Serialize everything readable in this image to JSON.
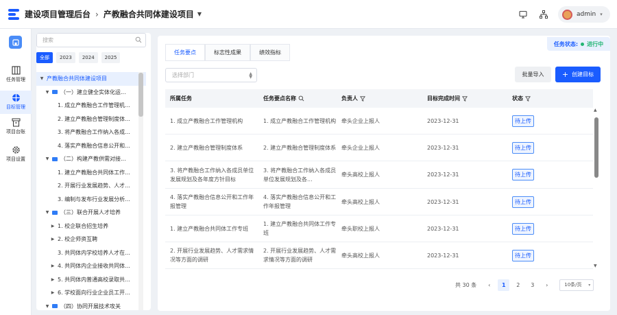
{
  "header": {
    "app_title": "建设项目管理后台",
    "project_title": "产教融合共同体建设项目",
    "user_name": "admin"
  },
  "leftnav": {
    "items": [
      {
        "label": "任务管理",
        "icon": "columns-icon"
      },
      {
        "label": "目标管理",
        "icon": "target-icon"
      },
      {
        "label": "项目台账",
        "icon": "ledger-icon"
      },
      {
        "label": "项目设置",
        "icon": "gear-icon"
      }
    ],
    "active_index": 1
  },
  "tree_panel": {
    "search_placeholder": "搜索",
    "years": [
      "全部",
      "2023",
      "2024",
      "2025"
    ],
    "active_year": "全部",
    "nodes": [
      {
        "label": "产教融合共同体建设项目",
        "level": 0,
        "arrow": "down",
        "selected": true,
        "folder": false
      },
      {
        "label": "（一）建立健全实体化运...",
        "level": 1,
        "arrow": "down",
        "folder": true
      },
      {
        "label": "1. 成立产教融合工作管理机...",
        "level": 2,
        "arrow": "",
        "folder": false
      },
      {
        "label": "2. 建立产教融合管理制度体...",
        "level": 2,
        "arrow": "",
        "folder": false
      },
      {
        "label": "3. 将产教融合工作纳入各成...",
        "level": 2,
        "arrow": "",
        "folder": false
      },
      {
        "label": "4. 落实产教融合信息公开和...",
        "level": 2,
        "arrow": "",
        "folder": false
      },
      {
        "label": "（二）构建产教供需对接...",
        "level": 1,
        "arrow": "down",
        "folder": true
      },
      {
        "label": "1. 建立产教融合共同体工作...",
        "level": 2,
        "arrow": "",
        "folder": false
      },
      {
        "label": "2. 开展行业发展趋势、人才...",
        "level": 2,
        "arrow": "",
        "folder": false
      },
      {
        "label": "3. 编制与发布行业发展分析...",
        "level": 2,
        "arrow": "",
        "folder": false
      },
      {
        "label": "（三）联合开展人才培养",
        "level": 1,
        "arrow": "down",
        "folder": true
      },
      {
        "label": "1. 校企联合招生培养",
        "level": 2,
        "arrow": "right",
        "folder": false
      },
      {
        "label": "2. 校企师资互聘",
        "level": 2,
        "arrow": "right",
        "folder": false
      },
      {
        "label": "3. 共同体内学校培养人才在...",
        "level": 2,
        "arrow": "",
        "folder": false
      },
      {
        "label": "4. 共同体内企业接收共同体...",
        "level": 2,
        "arrow": "right",
        "folder": false
      },
      {
        "label": "5. 共同体内普通高校录取共...",
        "level": 2,
        "arrow": "right",
        "folder": false
      },
      {
        "label": "6. 学校面向行业企业员工开...",
        "level": 2,
        "arrow": "right",
        "folder": false
      },
      {
        "label": "（四）协同开展技术攻关",
        "level": 1,
        "arrow": "down",
        "folder": true
      }
    ]
  },
  "main": {
    "status_label": "任务状态:",
    "status_value": "进行中",
    "tabs": [
      "任务要点",
      "标志性成果",
      "绩效指标"
    ],
    "active_tab": 0,
    "dept_placeholder": "选择部门",
    "import_label": "批量导入",
    "create_label": "创建目标",
    "columns": [
      "所属任务",
      "任务要点名称",
      "负责人",
      "目标完成时间",
      "状态"
    ],
    "rows": [
      {
        "task": "1. 成立产教融合工作管理机构",
        "point": "1. 成立产教融合工作管理机构",
        "owner": "牵头企业上报人",
        "date": "2023-12-31",
        "status": "待上传"
      },
      {
        "task": "2. 建立产教融合管理制度体系",
        "point": "2. 建立产教融合管理制度体系",
        "owner": "牵头企业上报人",
        "date": "2023-12-31",
        "status": "待上传"
      },
      {
        "task": "3. 将产教融合工作纳入各成员单位发展规划及各年度方针目标",
        "point": "3. 将产教融合工作纳入各成员单位发展规划及各...",
        "owner": "牵头高校上报人",
        "date": "2023-12-31",
        "status": "待上传"
      },
      {
        "task": "4. 落实产教融合信息公开和工作年报管理",
        "point": "4. 落实产教融合信息公开和工作年报管理",
        "owner": "牵头高校上报人",
        "date": "2023-12-31",
        "status": "待上传"
      },
      {
        "task": "1. 建立产教融合共同体工作专班",
        "point": "1. 建立产教融合共同体工作专班",
        "owner": "牵头职校上报人",
        "date": "2023-12-31",
        "status": "待上传"
      },
      {
        "task": "2. 开展行业发展趋势、人才需求情况等方面的调研",
        "point": "2. 开展行业发展趋势、人才需求情况等方面的调研",
        "owner": "牵头高校上报人",
        "date": "2023-12-31",
        "status": "待上传"
      }
    ],
    "pagination": {
      "total_text": "共 30 条",
      "pages": [
        "1",
        "2",
        "3"
      ],
      "current_page": "1",
      "page_size": "10条/页"
    }
  }
}
